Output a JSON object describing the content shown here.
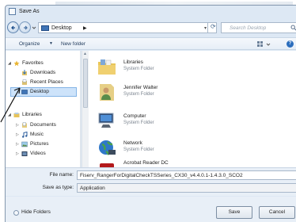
{
  "window": {
    "title": "Save As"
  },
  "address": {
    "location": "Desktop",
    "search_placeholder": "Search Desktop"
  },
  "toolbar": {
    "organize": "Organize",
    "new_folder": "New folder"
  },
  "nav_pane": {
    "favorites_header": "Favorites",
    "favorites": [
      "Downloads",
      "Recent Places",
      "Desktop"
    ],
    "libraries_header": "Libraries",
    "libraries": [
      "Documents",
      "Music",
      "Pictures",
      "Videos"
    ]
  },
  "content": {
    "items": [
      {
        "name": "Libraries",
        "type": "System Folder"
      },
      {
        "name": "Jennifer Walter",
        "type": "System Folder"
      },
      {
        "name": "Computer",
        "type": "System Folder"
      },
      {
        "name": "Network",
        "type": "System Folder"
      },
      {
        "name": "Acrobat Reader DC",
        "type": ""
      }
    ]
  },
  "form": {
    "file_name_label": "File name:",
    "file_name_value": "Fiserv_RangerForDigitalCheckTSSeries_CX30_v4.4.0.1-1.4.3.0_SCO2",
    "save_type_label": "Save as type:",
    "save_type_value": "Application"
  },
  "footer": {
    "hide_folders": "Hide Folders",
    "save": "Save",
    "cancel": "Cancel"
  },
  "colors": {
    "selection": "#cde3fa",
    "chrome": "#dde8f4",
    "accent": "#2c6ebd"
  }
}
